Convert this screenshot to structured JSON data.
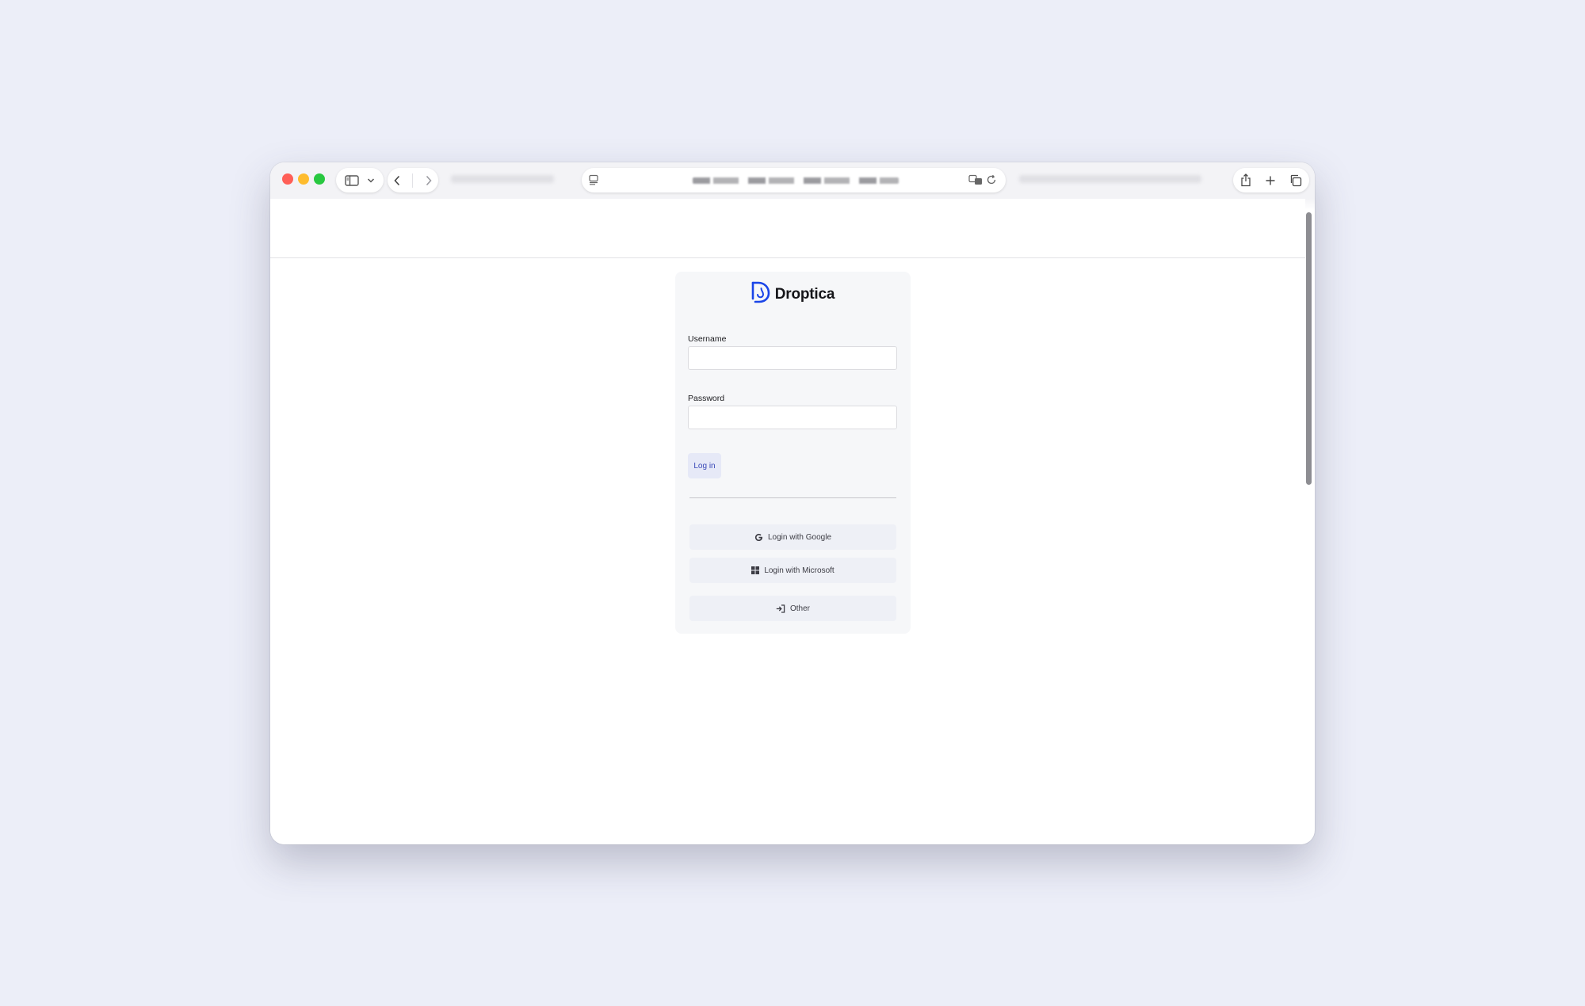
{
  "brand": {
    "name": "Droptica",
    "logo_color": "#1a45e8"
  },
  "form": {
    "username_label": "Username",
    "username_value": "",
    "password_label": "Password",
    "password_value": "",
    "login_button": "Log in"
  },
  "sso": {
    "google_label": "Login with Google",
    "microsoft_label": "Login with Microsoft",
    "other_label": "Other"
  },
  "browser": {
    "icons": [
      "sidebar-icon",
      "chevron-down-icon",
      "back-icon",
      "forward-icon",
      "reader-icon",
      "translate-icon",
      "reload-icon",
      "share-icon",
      "new-tab-icon",
      "tab-overview-icon"
    ]
  },
  "colors": {
    "background": "#eceef8",
    "card": "#f6f7f9",
    "accent_text": "#3a49b8",
    "accent_button": "#e6e9f7"
  }
}
